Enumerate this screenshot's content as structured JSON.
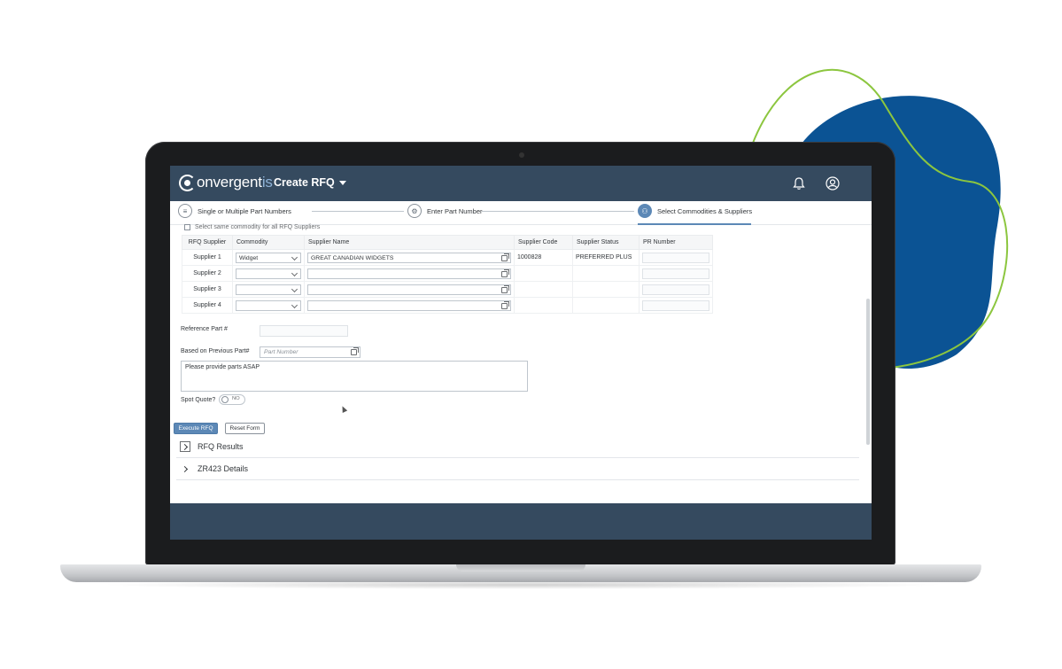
{
  "colors": {
    "shell_bar": "#354a5f",
    "accent": "#5c88b6",
    "blob_blue": "#0b5394",
    "blob_line": "#8cc63f"
  },
  "header": {
    "logo_main": "onvergent",
    "logo_tail": "is",
    "app_title": "Create RFQ",
    "icons": [
      "bell-icon",
      "user-profile-icon"
    ]
  },
  "wizard": {
    "steps": [
      {
        "label": "Single or Multiple Part Numbers",
        "icon": "list-icon"
      },
      {
        "label": "Enter Part Number",
        "icon": "gear-icon"
      },
      {
        "label": "Select Commodities & Suppliers",
        "icon": "people-icon",
        "active": true
      }
    ]
  },
  "form": {
    "same_commodity_label": "Select same commodity for all RFQ Suppliers",
    "table": {
      "headers": [
        "RFQ Supplier",
        "Commodity",
        "Supplier Name",
        "Supplier Code",
        "Supplier Status",
        "PR Number"
      ],
      "rows": [
        {
          "supplier": "Supplier 1",
          "commodity": "Widget",
          "name": "GREAT CANADIAN WIDGETS",
          "code": "1000828",
          "status": "PREFERRED PLUS",
          "pr": ""
        },
        {
          "supplier": "Supplier 2",
          "commodity": "",
          "name": "",
          "code": "",
          "status": "",
          "pr": ""
        },
        {
          "supplier": "Supplier 3",
          "commodity": "",
          "name": "",
          "code": "",
          "status": "",
          "pr": ""
        },
        {
          "supplier": "Supplier 4",
          "commodity": "",
          "name": "",
          "code": "",
          "status": "",
          "pr": ""
        }
      ]
    },
    "reference_part_label": "Reference Part #",
    "previous_part_label": "Based on Previous Part#",
    "previous_part_placeholder": "Part Number",
    "notes_value": "Please provide parts ASAP",
    "spot_quote_label": "Spot Quote?",
    "spot_quote_value": "NO",
    "execute_label": "Execute RFQ",
    "reset_label": "Reset Form"
  },
  "panels": [
    {
      "title": "RFQ Results"
    },
    {
      "title": "ZR423 Details"
    }
  ]
}
